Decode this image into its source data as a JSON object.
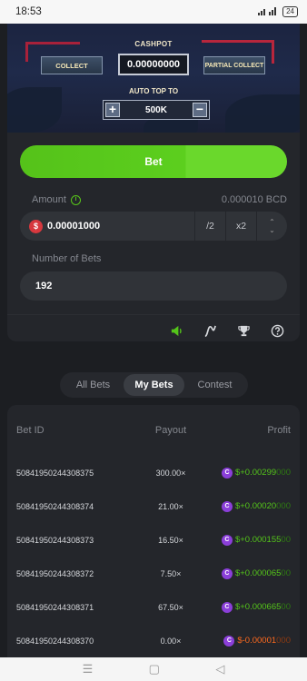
{
  "status_bar": {
    "time": "18:53",
    "signal": "··|l|··",
    "battery": "24"
  },
  "game": {
    "cashpot_label": "CASHPOT",
    "collect_label": "COLLECT",
    "cashpot_value": "0.00000000",
    "partial_collect_label": "PARTIAL COLLECT",
    "auto_top_label": "AUTO TOP TO",
    "auto_top_value": "500K",
    "minus": "−",
    "plus": "+"
  },
  "controls": {
    "bet_label": "Bet",
    "amount_label": "Amount",
    "amount_bcd": "0.000010 BCD",
    "amount_value": "0.00001000",
    "half_label": "/2",
    "double_label": "x2",
    "dollar": "$",
    "bets_label": "Number of Bets",
    "bets_value": "192"
  },
  "tabs": [
    {
      "label": "All Bets"
    },
    {
      "label": "My Bets"
    },
    {
      "label": "Contest"
    }
  ],
  "table": {
    "headers": {
      "bet_id": "Bet ID",
      "payout": "Payout",
      "profit": "Profit"
    },
    "rows": [
      {
        "id": "50841950244308375",
        "payout": "300.00×",
        "profit_main": "$+0.00299",
        "profit_dim": "000"
      },
      {
        "id": "50841950244308374",
        "payout": "21.00×",
        "profit_main": "$+0.00020",
        "profit_dim": "000"
      },
      {
        "id": "50841950244308373",
        "payout": "16.50×",
        "profit_main": "$+0.000155",
        "profit_dim": "00"
      },
      {
        "id": "50841950244308372",
        "payout": "7.50×",
        "profit_main": "$+0.000065",
        "profit_dim": "00"
      },
      {
        "id": "50841950244308371",
        "payout": "67.50×",
        "profit_main": "$+0.000665",
        "profit_dim": "00"
      },
      {
        "id": "50841950244308370",
        "payout": "0.00×",
        "profit_main": "$-0.00001",
        "profit_dim": "000"
      }
    ],
    "coin_symbol": "C"
  },
  "colors": {
    "accent_green": "#5ccf1e",
    "loss_orange": "#ff6a1e",
    "coin_purple": "#8b3fd9"
  },
  "icons": [
    "speaker-icon",
    "chart-curve-icon",
    "trophy-icon",
    "help-icon"
  ]
}
